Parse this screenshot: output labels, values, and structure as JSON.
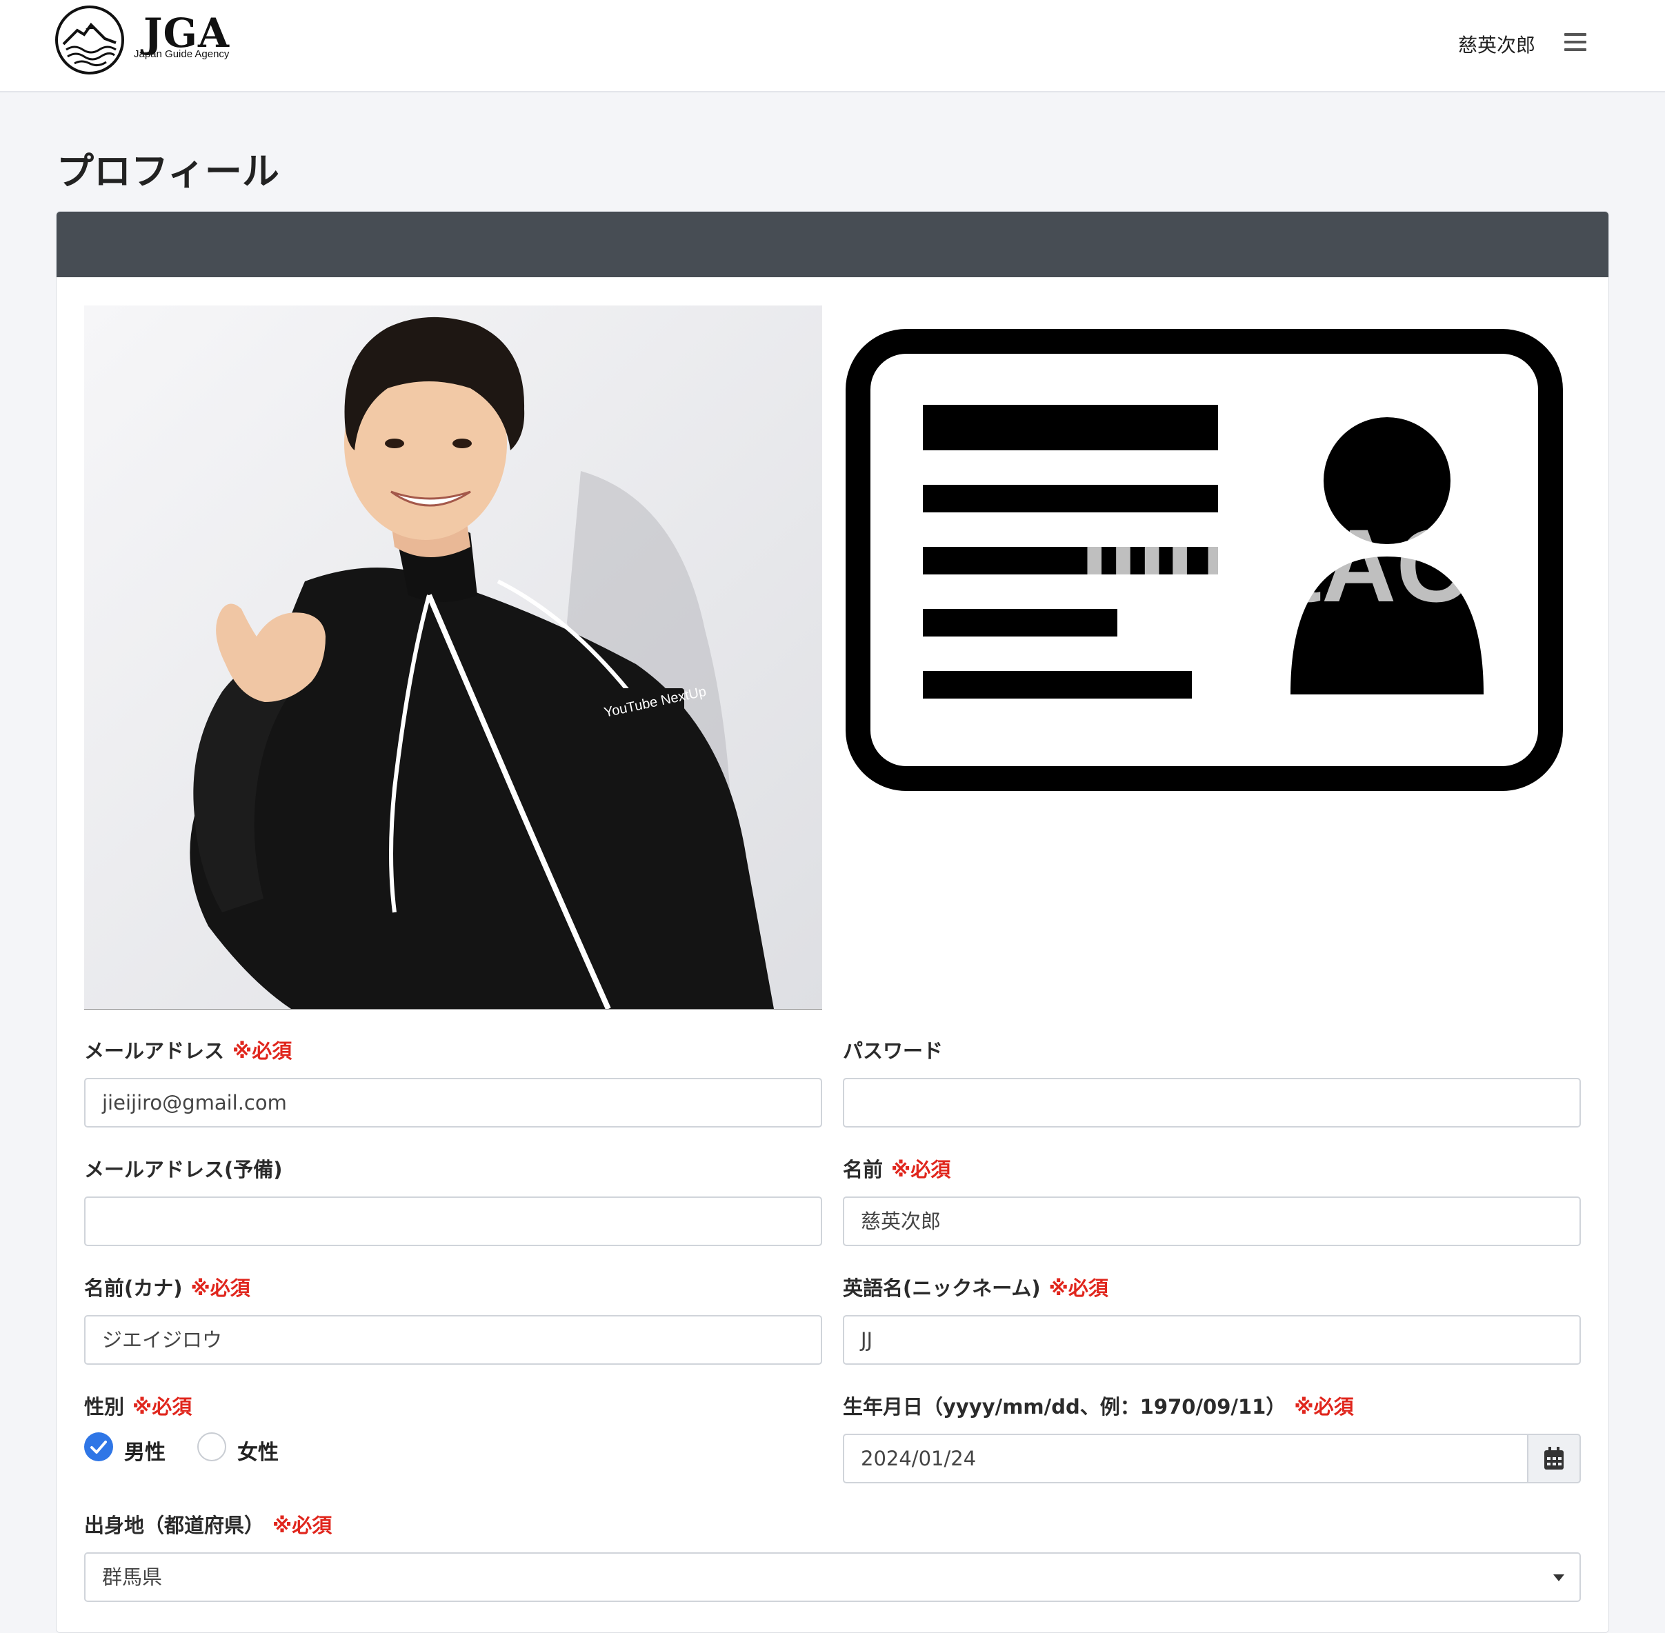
{
  "header": {
    "logo_text": "JGA",
    "logo_subtitle": "Japan Guide Agency",
    "user_name": "慈英次郎"
  },
  "page": {
    "title": "プロフィール"
  },
  "images": {
    "photo_logo_text": "YouTube NextUp",
    "idcard_watermark": "illustAC"
  },
  "required_mark": "※必須",
  "form": {
    "email": {
      "label": "メールアドレス",
      "value": "jieijiro@gmail.com",
      "required": true
    },
    "password": {
      "label": "パスワード",
      "value": "",
      "required": false
    },
    "email_backup": {
      "label": "メールアドレス(予備)",
      "value": "",
      "required": false
    },
    "name": {
      "label": "名前",
      "value": "慈英次郎",
      "required": true
    },
    "name_kana": {
      "label": "名前(カナ)",
      "value": "ジエイジロウ",
      "required": true
    },
    "english_name": {
      "label": "英語名(ニックネーム)",
      "value": "JJ",
      "required": true
    },
    "gender": {
      "label": "性別",
      "required": true,
      "options": [
        "男性",
        "女性"
      ],
      "selected": "男性"
    },
    "birthdate": {
      "label": "生年月日（yyyy/mm/dd、例：1970/09/11）",
      "value": "2024/01/24",
      "required": true
    },
    "birthplace": {
      "label": "出身地（都道府県）",
      "value": "群馬県",
      "required": true
    }
  },
  "colors": {
    "accent": "#2f76e6",
    "required": "#e0261d",
    "card_header": "#474d54",
    "page_bg": "#f4f5f8"
  },
  "icons": [
    "mountain-wave-logo-icon",
    "hamburger-menu-icon",
    "check-icon",
    "calendar-icon",
    "chevron-down-icon"
  ]
}
